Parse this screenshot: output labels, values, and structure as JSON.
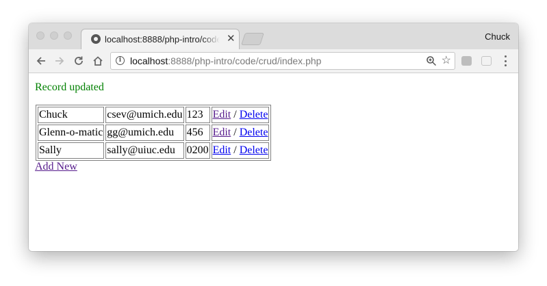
{
  "browser": {
    "tab_title": "localhost:8888/php-intro/code/crud/index.php",
    "profile_name": "Chuck",
    "url_host": "localhost",
    "url_rest": ":8888/php-intro/code/crud/index.php"
  },
  "page": {
    "flash_message": "Record updated",
    "flash_color": "#008000",
    "separator": "/",
    "add_new_label": "Add New",
    "rows": [
      {
        "name": "Chuck",
        "email": "csev@umich.edu",
        "password": "123",
        "edit_label": "Edit",
        "delete_label": "Delete"
      },
      {
        "name": "Glenn-o-matic",
        "email": "gg@umich.edu",
        "password": "456",
        "edit_label": "Edit",
        "delete_label": "Delete"
      },
      {
        "name": "Sally",
        "email": "sally@uiuc.edu",
        "password": "0200",
        "edit_label": "Edit",
        "delete_label": "Delete"
      }
    ]
  },
  "icons": {
    "favicon": "favicon-icon",
    "tab_close": "close-icon",
    "back": "back-arrow-icon",
    "forward": "forward-arrow-icon",
    "reload": "reload-icon",
    "home": "home-icon",
    "site_info": "info-icon",
    "zoom": "zoom-icon",
    "bookmark": "star-icon",
    "menu": "kebab-menu-icon"
  },
  "colors": {
    "link": "#0000ee",
    "visited_link": "#551a8b"
  }
}
